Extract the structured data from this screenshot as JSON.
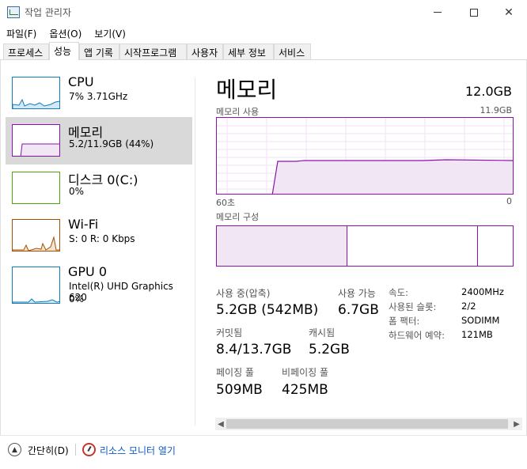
{
  "window": {
    "title": "작업 관리자"
  },
  "menu": [
    "파일(F)",
    "옵션(O)",
    "보기(V)"
  ],
  "tabs": [
    "프로세스",
    "성능",
    "앱 기록",
    "시작프로그램",
    "사용자",
    "세부 정보",
    "서비스"
  ],
  "active_tab": "성능",
  "sidebar": {
    "items": [
      {
        "name": "CPU",
        "sub": "7% 3.71GHz",
        "sub2": "",
        "color": "#117dbb",
        "selected": false
      },
      {
        "name": "메모리",
        "sub": "5.2/11.9GB (44%)",
        "sub2": "",
        "color": "#8b12ae",
        "selected": true
      },
      {
        "name": "디스크 0(C:)",
        "sub": "0%",
        "sub2": "",
        "color": "#4da60c",
        "selected": false
      },
      {
        "name": "Wi-Fi",
        "sub": "S: 0 R: 0 Kbps",
        "sub2": "",
        "color": "#a74f01",
        "selected": false
      },
      {
        "name": "GPU 0",
        "sub": "Intel(R) UHD Graphics 620",
        "sub2": "0%",
        "color": "#117dbb",
        "selected": false
      }
    ]
  },
  "main": {
    "title": "메모리",
    "total": "12.0GB",
    "usage_graph": {
      "label": "메모리 사용",
      "max_label": "11.9GB",
      "left_axis": "60초",
      "right_axis": "0",
      "current_fraction": 0.44
    },
    "composition": {
      "label": "메모리 구성",
      "in_use_fraction": 0.44,
      "modified_fraction": 0.001,
      "standby_fraction": 0.44
    },
    "stats": {
      "in_use_label": "사용 중(압축)",
      "in_use_value": "5.2GB (542MB)",
      "available_label": "사용 가능",
      "available_value": "6.7GB",
      "committed_label": "커밋됨",
      "committed_value": "8.4/13.7GB",
      "cached_label": "캐시됨",
      "cached_value": "5.2GB",
      "paged_label": "페이징 풀",
      "paged_value": "509MB",
      "nonpaged_label": "비페이징 풀",
      "nonpaged_value": "425MB"
    },
    "details": [
      {
        "label": "속도:",
        "value": "2400MHz"
      },
      {
        "label": "사용된 슬롯:",
        "value": "2/2"
      },
      {
        "label": "폼 팩터:",
        "value": "SODIMM"
      },
      {
        "label": "하드웨어 예약:",
        "value": "121MB"
      }
    ]
  },
  "footer": {
    "collapse_label": "간단히(D)",
    "resmon_label": "리소스 모니터 열기"
  }
}
